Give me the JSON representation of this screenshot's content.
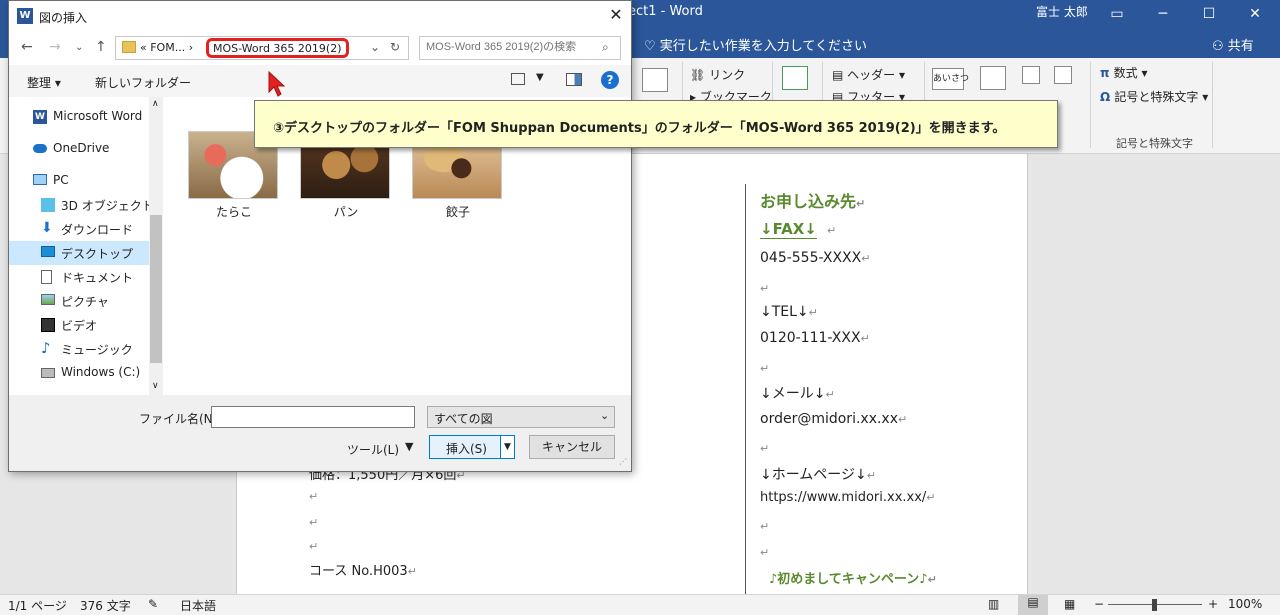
{
  "word": {
    "title": "ect1 - Word",
    "user": "富士 太郎",
    "tell_me": "実行したい作業を入力してください",
    "share": "共有",
    "ribbon": {
      "link": "リンク",
      "bookmark": "ブックマーク",
      "header": "ヘッダー",
      "footer": "フッター",
      "aisatsu": "あいさつ",
      "equation": "数式",
      "symbol": "記号と特殊文字",
      "group_symbols": "記号と特殊文字"
    },
    "doc": {
      "price_line": "価格：1,550円／月×6回",
      "course": "コース No.H003",
      "apply_heading": "お申し込み先",
      "fax_heading": "↓FAX↓",
      "fax": "045-555-XXXX",
      "tel_heading": "↓TEL↓",
      "tel": "0120-111-XXX",
      "mail_heading": "↓メール↓",
      "mail": "order@midori.xx.xx",
      "homepage_heading": "↓ホームページ↓",
      "homepage": "https://www.midori.xx.xx/",
      "campaign": "♪初めましてキャンペーン♪"
    },
    "status": {
      "page": "1/1 ページ",
      "words": "376 文字",
      "language": "日本語",
      "zoom": "100%"
    }
  },
  "dialog": {
    "title": "図の挿入",
    "breadcrumb_parent": "«  FOM...  ›",
    "current_folder": "MOS-Word 365 2019(2)",
    "search_placeholder": "MOS-Word 365 2019(2)の検索",
    "organize": "整理 ▾",
    "new_folder": "新しいフォルダー",
    "nav_items": [
      {
        "label": "Microsoft Word",
        "icon": "word-icon"
      },
      {
        "label": "OneDrive",
        "icon": "cloud-icon"
      },
      {
        "label": "PC",
        "icon": "pc-icon"
      },
      {
        "label": "3D オブジェクト",
        "icon": "3d-objects-icon"
      },
      {
        "label": "ダウンロード",
        "icon": "download-icon"
      },
      {
        "label": "デスクトップ",
        "icon": "desktop-icon"
      },
      {
        "label": "ドキュメント",
        "icon": "documents-icon"
      },
      {
        "label": "ピクチャ",
        "icon": "pictures-icon"
      },
      {
        "label": "ビデオ",
        "icon": "videos-icon"
      },
      {
        "label": "ミュージック",
        "icon": "music-icon"
      },
      {
        "label": "Windows (C:)",
        "icon": "drive-icon"
      }
    ],
    "files": [
      {
        "name": "たらこ"
      },
      {
        "name": "パン"
      },
      {
        "name": "餃子"
      }
    ],
    "file_name_label": "ファイル名(N):",
    "file_name_value": "",
    "filter": "すべての図",
    "tools": "ツール(L)",
    "insert": "挿入(S)",
    "cancel": "キャンセル"
  },
  "callout": {
    "text": "③デスクトップのフォルダー「FOM Shuppan Documents」のフォルダー「MOS-Word 365 2019(2)」を開きます。"
  },
  "colors": {
    "word_blue": "#2b579a",
    "highlight_red": "#e52020",
    "callout_bg": "#ffffcc",
    "doc_green": "#5a8a2f",
    "selected_nav": "#cce8ff"
  }
}
